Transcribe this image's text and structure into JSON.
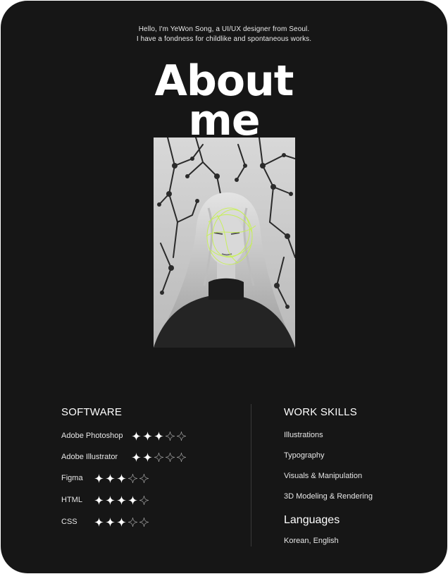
{
  "intro": {
    "line1": "Hello, I'm YeWon Song, a UI/UX designer from Seoul.",
    "line2": "I have a fondness for childlike and spontaneous works."
  },
  "title": {
    "line1": "About",
    "line2": "me"
  },
  "photo": {
    "icon": "portrait-photo",
    "accent_color": "#c6f24e"
  },
  "software": {
    "title": "SOFTWARE",
    "max_rating": 5,
    "items": [
      {
        "name": "Adobe Photoshop",
        "rating": 3
      },
      {
        "name": "Adobe Illustrator",
        "rating": 2
      },
      {
        "name": "Figma",
        "rating": 3
      },
      {
        "name": "HTML",
        "rating": 4
      },
      {
        "name": "CSS",
        "rating": 3
      }
    ]
  },
  "work_skills": {
    "title": "WORK SKILLS",
    "items": [
      "Illustrations",
      "Typography",
      "Visuals & Manipulation",
      "3D Modeling & Rendering"
    ]
  },
  "languages": {
    "title": "Languages",
    "value": "Korean, English"
  },
  "colors": {
    "background": "#161616",
    "text": "#ffffff",
    "accent": "#c6f24e"
  }
}
